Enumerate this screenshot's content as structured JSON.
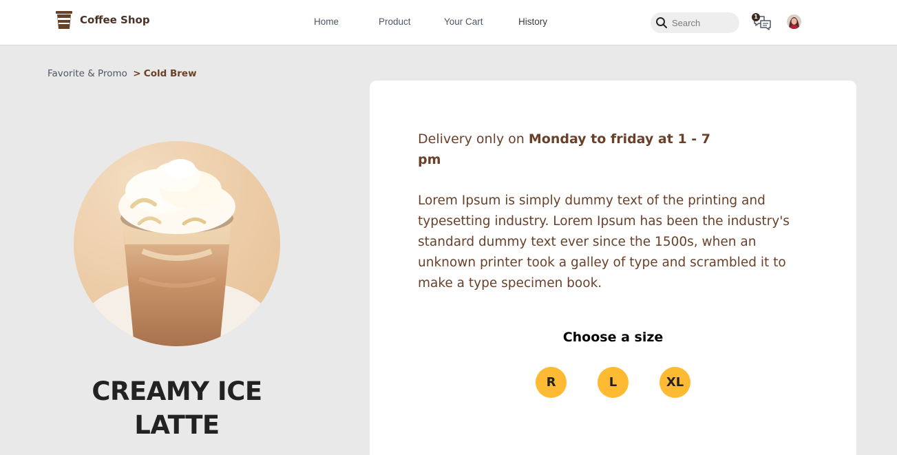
{
  "brand": {
    "name": "Coffee Shop"
  },
  "nav": {
    "items": [
      {
        "label": "Home"
      },
      {
        "label": "Product"
      },
      {
        "label": "Your Cart"
      },
      {
        "label": "History"
      }
    ]
  },
  "search": {
    "placeholder": "Search",
    "value": ""
  },
  "chat": {
    "badge_count": "1"
  },
  "breadcrumb": {
    "parent": "Favorite & Promo",
    "separator": ">",
    "current": "Cold Brew"
  },
  "product": {
    "name": "CREAMY ICE LATTE",
    "delivery_prefix": "Delivery only on",
    "delivery_schedule": "Monday to friday at 1 - 7 pm",
    "description": "Lorem Ipsum is simply dummy text of the printing and typesetting industry. Lorem Ipsum has been the industry's standard dummy text ever since the 1500s, when an unknown printer took a galley of type and scrambled it to make a type specimen book."
  },
  "size": {
    "title": "Choose a size",
    "options": [
      "R",
      "L",
      "XL"
    ]
  },
  "colors": {
    "brand_brown": "#6a4029",
    "accent_yellow": "#ffba33",
    "page_background": "#e9e9e9"
  },
  "icons": {
    "logo": "coffee-cup-icon",
    "search": "search-icon",
    "chat": "chat-icon"
  }
}
